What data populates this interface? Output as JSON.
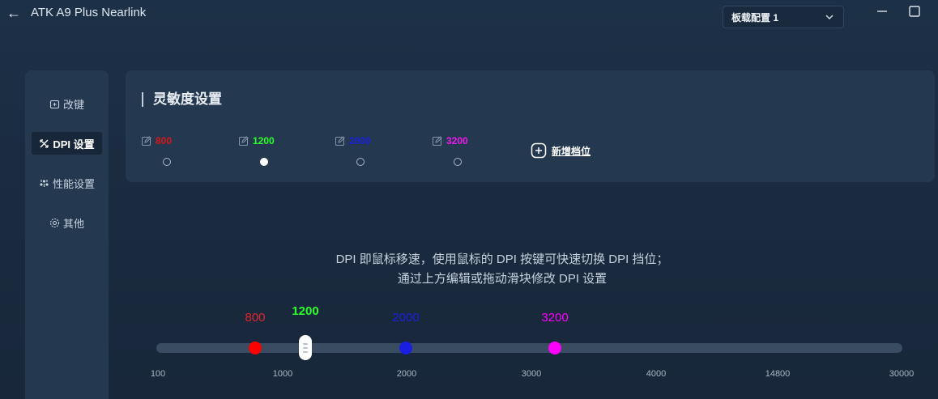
{
  "app": {
    "title": "ATK A9 Plus Nearlink"
  },
  "profile": {
    "selected": "板载配置 1"
  },
  "sidebar": {
    "items": [
      {
        "label": "改键",
        "icon": "remap-icon"
      },
      {
        "label": "DPI 设置",
        "icon": "dpi-icon",
        "active": true
      },
      {
        "label": "性能设置",
        "icon": "performance-icon"
      },
      {
        "label": "其他",
        "icon": "gear-icon"
      }
    ]
  },
  "card": {
    "title": "灵敏度设置",
    "stages": [
      {
        "value": "800",
        "color": "#d7161b",
        "selected": false
      },
      {
        "value": "1200",
        "color": "#2bff2b",
        "selected": true
      },
      {
        "value": "2000",
        "color": "#1a1ee0",
        "selected": false
      },
      {
        "value": "3200",
        "color": "#ee1aee",
        "selected": false
      }
    ],
    "add_label": "新增档位"
  },
  "description": {
    "line1": "DPI 即鼠标移速，使用鼠标的 DPI 按键可快速切换 DPI 挡位；",
    "line2": "通过上方编辑或拖动滑块修改 DPI 设置"
  },
  "slider": {
    "ticks": [
      "100",
      "1000",
      "2000",
      "3000",
      "4000",
      "14800",
      "30000"
    ],
    "markers": [
      {
        "value": "800",
        "color": "#ff0000"
      },
      {
        "value": "1200",
        "color": "#2bff2b",
        "active": true
      },
      {
        "value": "2000",
        "color": "#1a1ee0"
      },
      {
        "value": "3200",
        "color": "#ff00ff"
      }
    ]
  }
}
